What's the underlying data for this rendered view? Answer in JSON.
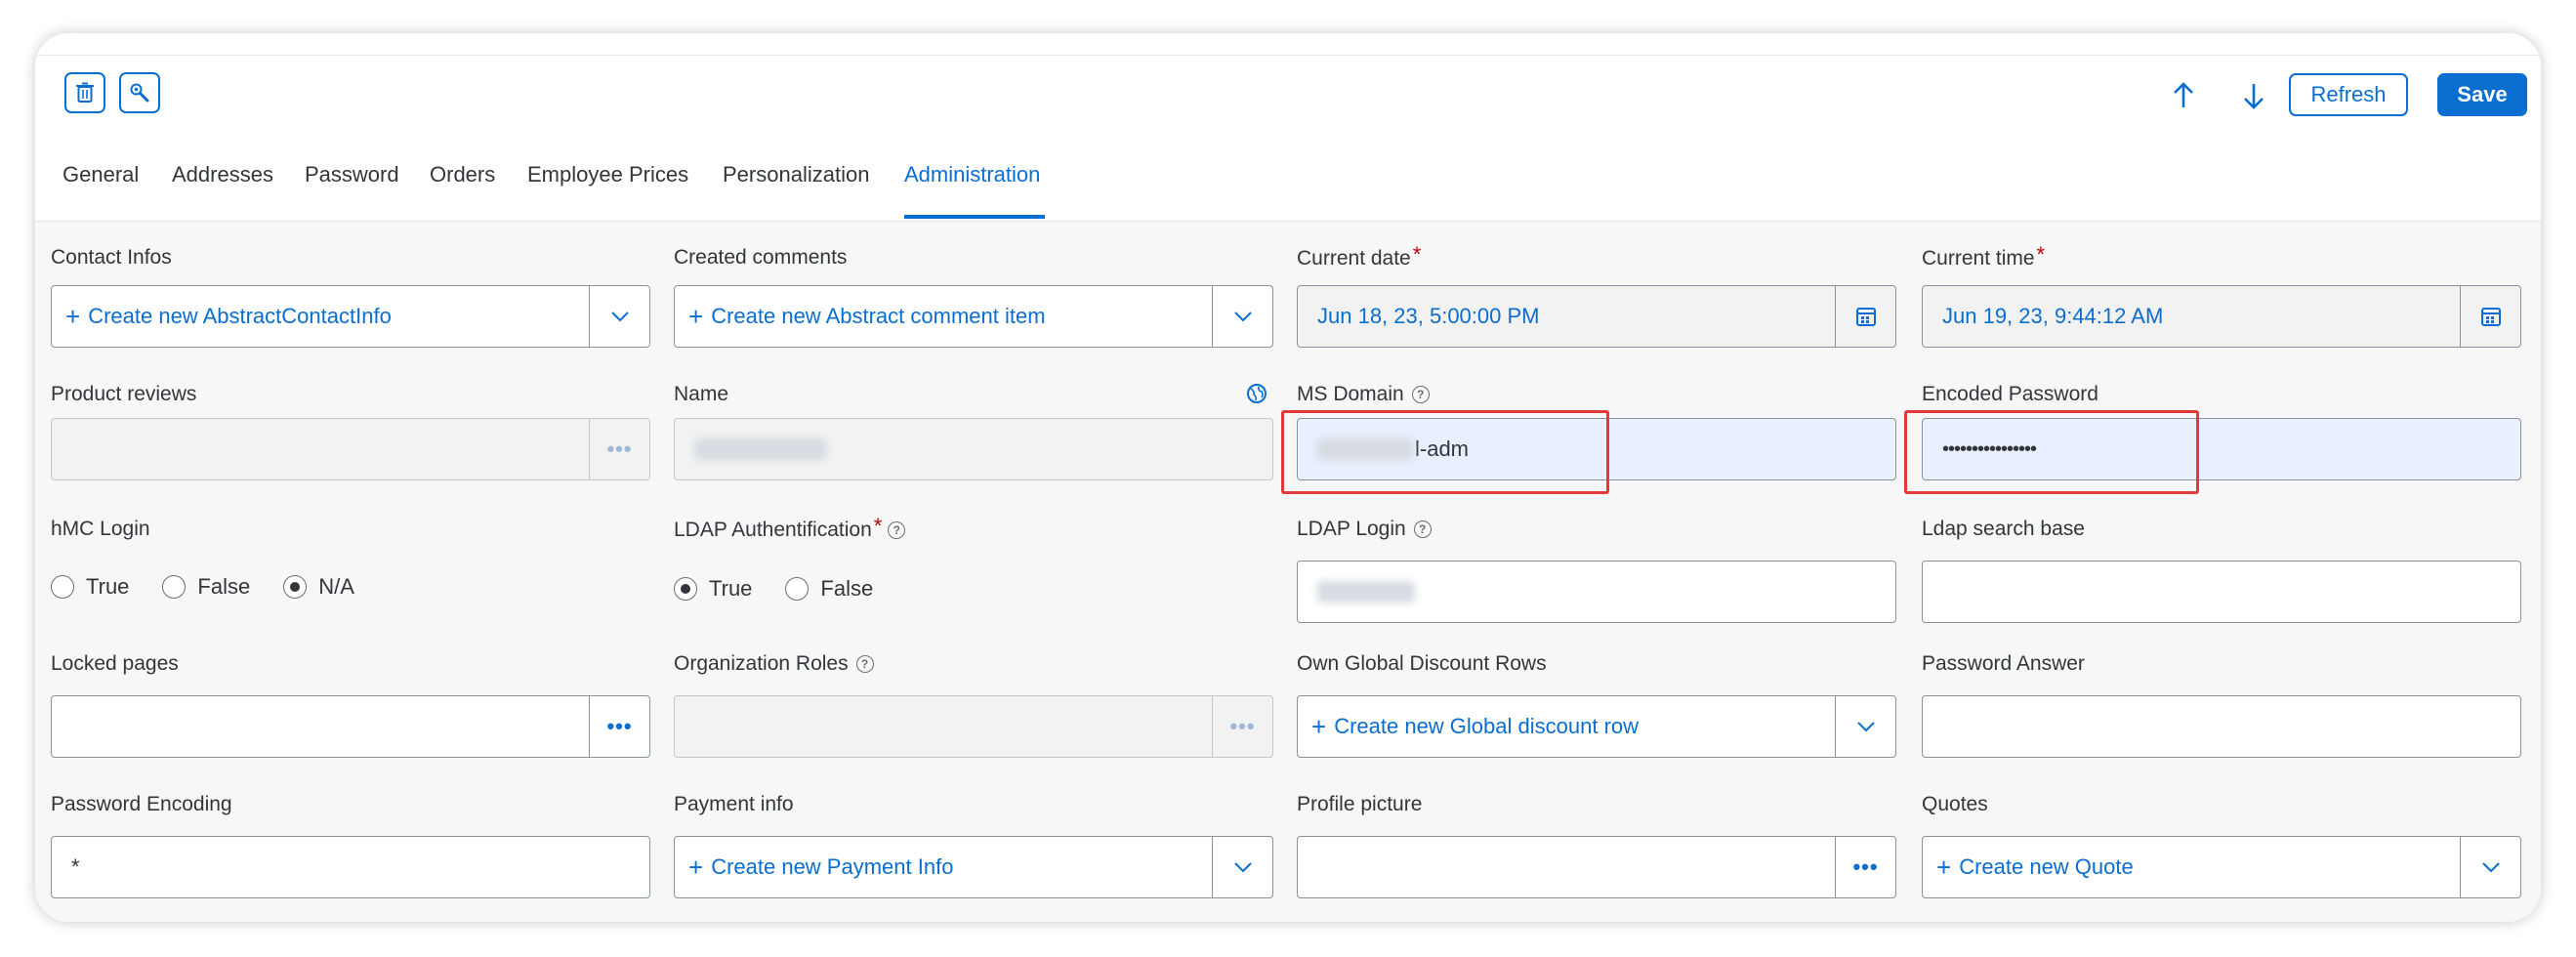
{
  "toolbar": {
    "delete_icon": "trash-icon",
    "edit_icon": "wrench-icon",
    "up_icon": "arrow-up-icon",
    "down_icon": "arrow-down-icon",
    "refresh_label": "Refresh",
    "save_label": "Save"
  },
  "tabs": [
    {
      "label": "General"
    },
    {
      "label": "Addresses"
    },
    {
      "label": "Password"
    },
    {
      "label": "Orders"
    },
    {
      "label": "Employee Prices"
    },
    {
      "label": "Personalization"
    },
    {
      "label": "Administration"
    }
  ],
  "active_tab": "Administration",
  "fields": {
    "contact_infos": {
      "label": "Contact Infos",
      "value": "Create new AbstractContactInfo"
    },
    "created_comments": {
      "label": "Created comments",
      "value": "Create new Abstract comment item"
    },
    "current_date": {
      "label": "Current date",
      "value": "Jun 18, 23, 5:00:00 PM",
      "required": "*"
    },
    "current_time": {
      "label": "Current time",
      "value": "Jun 19, 23, 9:44:12 AM",
      "required": "*"
    },
    "product_reviews": {
      "label": "Product reviews",
      "value": ""
    },
    "name": {
      "label": "Name",
      "value": ""
    },
    "ms_domain": {
      "label": "MS Domain",
      "value": "l-adm"
    },
    "encoded_password": {
      "label": "Encoded Password",
      "value": "••••••••••••••••"
    },
    "hmc_login": {
      "label": "hMC Login",
      "options": [
        "True",
        "False",
        "N/A"
      ],
      "selected": "N/A"
    },
    "ldap_auth": {
      "label": "LDAP Authentification",
      "required": "*",
      "options": [
        "True",
        "False"
      ],
      "selected": "True"
    },
    "ldap_login": {
      "label": "LDAP Login",
      "value": ""
    },
    "ldap_search_base": {
      "label": "Ldap search base",
      "value": ""
    },
    "locked_pages": {
      "label": "Locked pages",
      "value": ""
    },
    "organization_roles": {
      "label": "Organization Roles",
      "value": ""
    },
    "own_global_discount_rows": {
      "label": "Own Global Discount Rows",
      "value": "Create new Global discount row"
    },
    "password_answer": {
      "label": "Password Answer",
      "value": ""
    },
    "password_encoding": {
      "label": "Password Encoding",
      "value": "*"
    },
    "payment_info": {
      "label": "Payment info",
      "value": "Create new Payment Info"
    },
    "profile_picture": {
      "label": "Profile picture",
      "value": ""
    },
    "quotes": {
      "label": "Quotes",
      "value": "Create new Quote"
    }
  },
  "colors": {
    "accent": "#0a6ed1",
    "required": "#bb0000",
    "highlight": "#e03a3a",
    "highlight_fill": "#e8f0fd"
  }
}
